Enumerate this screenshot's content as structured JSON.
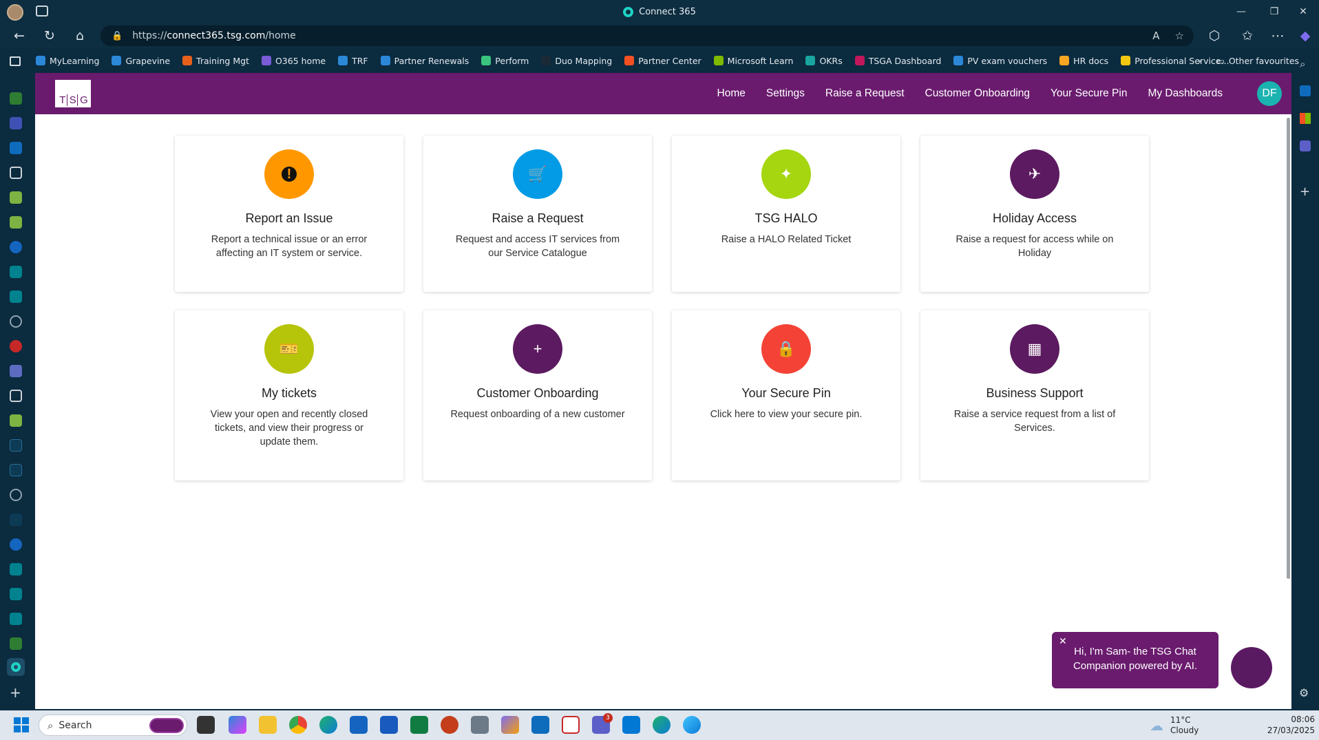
{
  "window": {
    "title": "Connect 365"
  },
  "address_bar": {
    "url_prefix": "https://",
    "url_host": "connect365.tsg.com",
    "url_path": "/home"
  },
  "favourites": [
    {
      "label": "MyLearning",
      "color": "#2b88d8"
    },
    {
      "label": "Grapevine",
      "color": "#2b88d8"
    },
    {
      "label": "Training Mgt",
      "color": "#e8601c"
    },
    {
      "label": "O365 home",
      "color": "#7a5cd6"
    },
    {
      "label": "TRF",
      "color": "#2b88d8"
    },
    {
      "label": "Partner Renewals",
      "color": "#2b88d8"
    },
    {
      "label": "Perform",
      "color": "#3ac47d"
    },
    {
      "label": "Duo Mapping",
      "color": "#1a2a36"
    },
    {
      "label": "Partner Center",
      "color": "#f25022"
    },
    {
      "label": "Microsoft Learn",
      "color": "#7fba00"
    },
    {
      "label": "OKRs",
      "color": "#1aa5a0"
    },
    {
      "label": "TSGA Dashboard",
      "color": "#c2185b"
    },
    {
      "label": "PV exam vouchers",
      "color": "#2b88d8"
    },
    {
      "label": "HR docs",
      "color": "#f5a623"
    },
    {
      "label": "Professional Service...",
      "color": "#f2c811"
    }
  ],
  "favourites_other": "Other favourites",
  "logo": {
    "letters": [
      "T",
      "S",
      "G"
    ]
  },
  "nav": {
    "items": [
      "Home",
      "Settings",
      "Raise a Request",
      "Customer Onboarding",
      "Your Secure Pin",
      "My Dashboards"
    ],
    "user_initials": "DF"
  },
  "cards": [
    {
      "title": "Report an Issue",
      "desc": "Report a technical issue or an error affecting an IT system or service.",
      "color": "#ff9800",
      "icon": "exclamation-icon",
      "glyph": "!"
    },
    {
      "title": "Raise a Request",
      "desc": "Request and access IT services from our Service Catalogue",
      "color": "#039be5",
      "icon": "cart-icon",
      "glyph": "🛒"
    },
    {
      "title": "TSG HALO",
      "desc": "Raise a HALO Related Ticket",
      "color": "#a5d610",
      "icon": "sparkles-icon",
      "glyph": "✦"
    },
    {
      "title": "Holiday Access",
      "desc": "Raise a request for access while on Holiday",
      "color": "#5c1a60",
      "icon": "plane-icon",
      "glyph": "✈"
    },
    {
      "title": "My tickets",
      "desc": "View your open and recently closed tickets, and view their progress or update them.",
      "color": "#b6c40a",
      "icon": "ticket-icon",
      "glyph": "🎫"
    },
    {
      "title": "Customer Onboarding",
      "desc": "Request onboarding of a new customer",
      "color": "#5c1a60",
      "icon": "plus-circle-icon",
      "glyph": "+"
    },
    {
      "title": "Your Secure Pin",
      "desc": "Click here to view your secure pin.",
      "color": "#f44336",
      "icon": "lock-icon",
      "glyph": "🔒"
    },
    {
      "title": "Business Support",
      "desc": "Raise a service request from a list of Services.",
      "color": "#5c1a60",
      "icon": "building-icon",
      "glyph": "▦"
    }
  ],
  "chat": {
    "line1": "Hi, I'm Sam- the TSG Chat",
    "line2": "Companion powered by AI."
  },
  "taskbar": {
    "search_placeholder": "Search",
    "weather_temp": "11°C",
    "weather_text": "Cloudy",
    "time": "08:06",
    "date": "27/03/2025",
    "teams_badge": "3"
  }
}
